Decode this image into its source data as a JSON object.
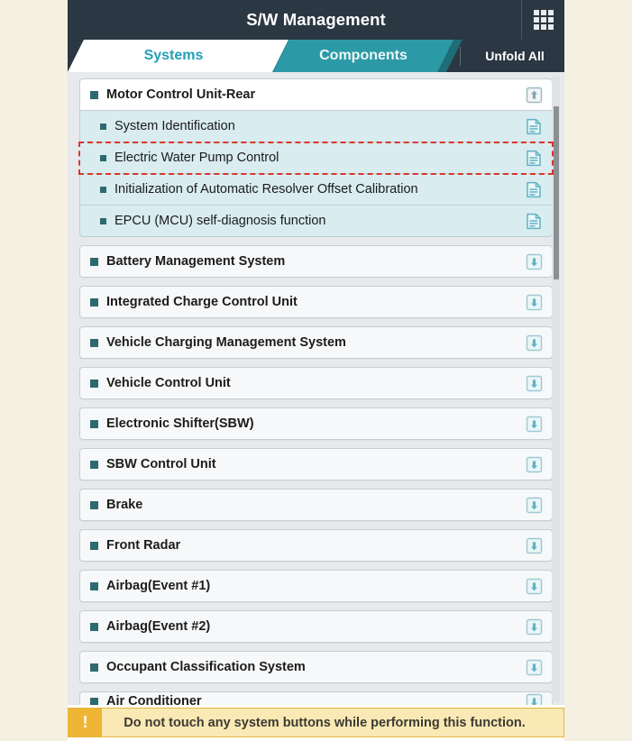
{
  "app": {
    "title": "S/W Management",
    "grid_icon": "grid-menu-icon"
  },
  "tabs": [
    {
      "label": "Systems",
      "active": true
    },
    {
      "label": "Components",
      "active": false
    }
  ],
  "toolbar": {
    "unfold_all_label": "Unfold All"
  },
  "list": {
    "expanded_group": {
      "label": "Motor Control Unit-Rear",
      "collapse_icon": "collapse-up-box-icon",
      "children": [
        {
          "label": "System Identification",
          "icon": "document-icon",
          "selected": false
        },
        {
          "label": "Electric Water Pump Control",
          "icon": "document-icon",
          "selected": true
        },
        {
          "label": "Initialization of Automatic Resolver Offset Calibration",
          "icon": "document-icon",
          "selected": false
        },
        {
          "label": "EPCU (MCU) self-diagnosis function",
          "icon": "document-icon",
          "selected": false
        }
      ]
    },
    "collapsed_items": [
      {
        "label": "Battery Management System",
        "icon": "expand-down-box-icon"
      },
      {
        "label": "Integrated Charge Control Unit",
        "icon": "expand-down-box-icon"
      },
      {
        "label": "Vehicle Charging Management System",
        "icon": "expand-down-box-icon"
      },
      {
        "label": "Vehicle Control Unit",
        "icon": "expand-down-box-icon"
      },
      {
        "label": "Electronic Shifter(SBW)",
        "icon": "expand-down-box-icon"
      },
      {
        "label": "SBW Control Unit",
        "icon": "expand-down-box-icon"
      },
      {
        "label": "Brake",
        "icon": "expand-down-box-icon"
      },
      {
        "label": "Front Radar",
        "icon": "expand-down-box-icon"
      },
      {
        "label": "Airbag(Event #1)",
        "icon": "expand-down-box-icon"
      },
      {
        "label": "Airbag(Event #2)",
        "icon": "expand-down-box-icon"
      },
      {
        "label": "Occupant Classification System",
        "icon": "expand-down-box-icon"
      },
      {
        "label": "Air Conditioner",
        "icon": "expand-down-box-icon"
      }
    ]
  },
  "warning": {
    "icon": "exclamation-icon",
    "icon_glyph": "!",
    "message": "Do not touch any system buttons while performing this function."
  },
  "colors": {
    "page_background": "#f4f1e2",
    "title_bar": "#2b3742",
    "tab_bar": "#2b3742",
    "tab_active_text": "#22a0b5",
    "tab_inactive_bg": "#2c9aa6",
    "sub_row_bg": "#d9ecef",
    "selection_outline": "#d9362b",
    "bullet": "#2d6a6f",
    "warning_bg": "#fae9b4",
    "warning_icon_bg": "#efb535",
    "icon_accent": "#5fb3c4"
  }
}
